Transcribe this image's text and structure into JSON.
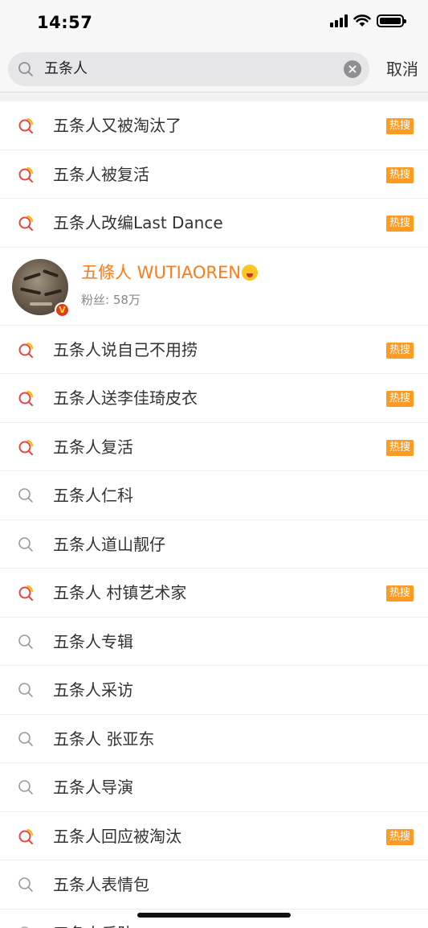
{
  "status_bar": {
    "time": "14:57"
  },
  "search": {
    "value": "五条人",
    "cancel_label": "取消"
  },
  "colors": {
    "accent": "#ff7b17",
    "hot_badge": "#ff9a23",
    "hot_icon_red": "#e8453c",
    "hot_icon_yellow": "#ffb400"
  },
  "hot_badge_label": "热搜",
  "suggestions_top": [
    {
      "text": "五条人又被淘汰了",
      "hot": true
    },
    {
      "text": "五条人被复活",
      "hot": true
    },
    {
      "text": "五条人改编Last Dance",
      "hot": true
    }
  ],
  "user": {
    "name": "五條人 WUTIAOREN",
    "fans": "粉丝: 58万",
    "verified_badge": "V"
  },
  "suggestions_bottom": [
    {
      "text": "五条人说自己不用捞",
      "hot": true
    },
    {
      "text": "五条人送李佳琦皮衣",
      "hot": true
    },
    {
      "text": "五条人复活",
      "hot": true
    },
    {
      "text": "五条人仁科",
      "hot": false
    },
    {
      "text": "五条人道山靓仔",
      "hot": false
    },
    {
      "text": "五条人 村镇艺术家",
      "hot": true
    },
    {
      "text": "五条人专辑",
      "hot": false
    },
    {
      "text": "五条人采访",
      "hot": false
    },
    {
      "text": "五条人 张亚东",
      "hot": false
    },
    {
      "text": "五条人导演",
      "hot": false
    },
    {
      "text": "五条人回应被淘汰",
      "hot": true
    },
    {
      "text": "五条人表情包",
      "hot": false
    }
  ],
  "partial_row": {
    "text": "五条人乐队"
  }
}
